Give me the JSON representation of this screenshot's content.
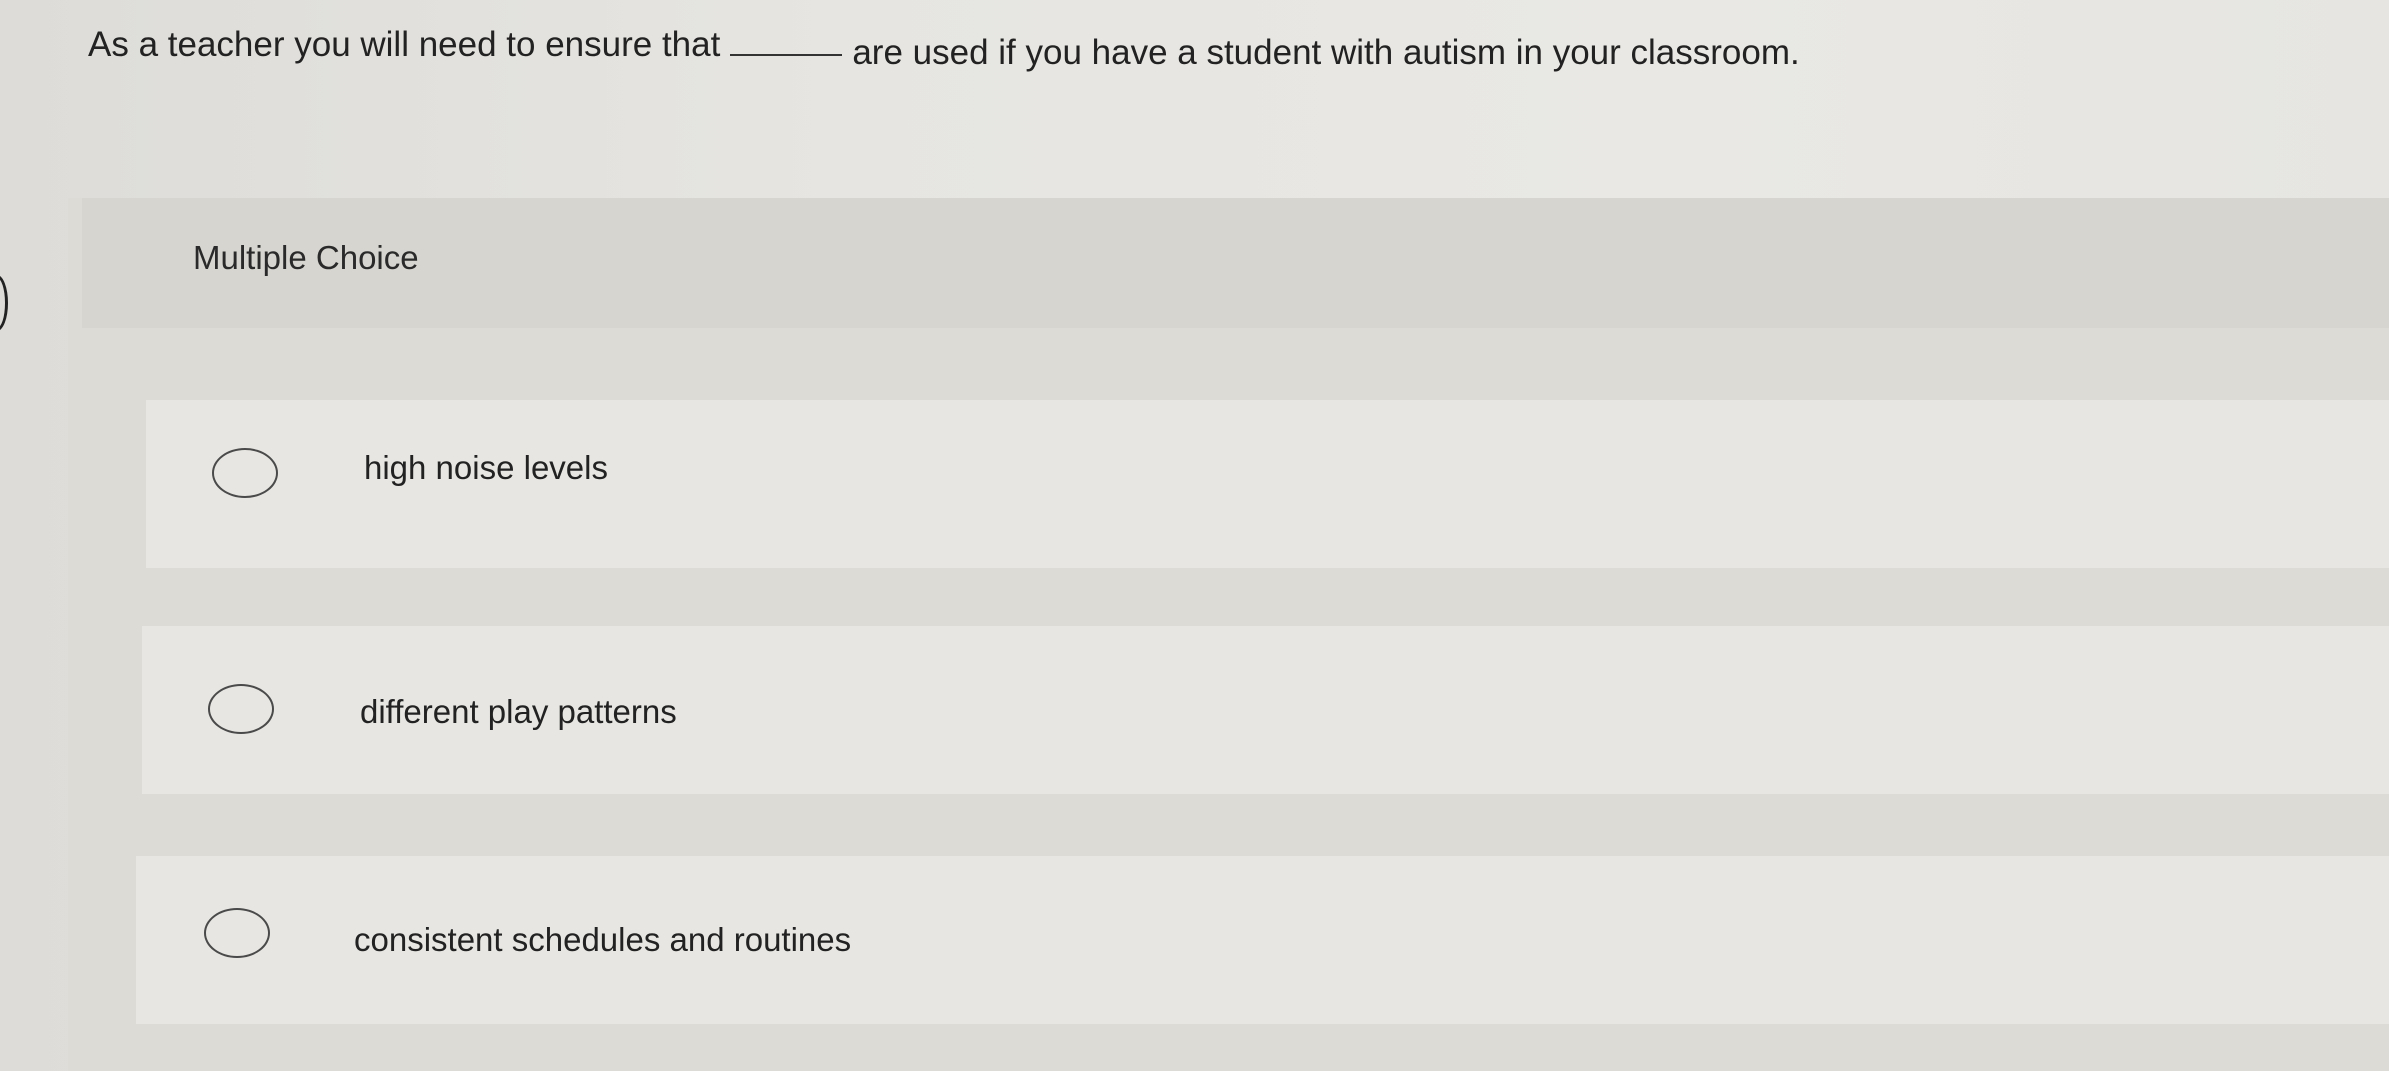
{
  "question": {
    "text_before": "As a teacher you will need to ensure that",
    "text_after": "are used if you have a student with autism in your classroom."
  },
  "multiple_choice": {
    "label": "Multiple Choice",
    "options": [
      {
        "label": "high noise levels",
        "selected": false
      },
      {
        "label": "different play patterns",
        "selected": false
      },
      {
        "label": "consistent schedules and routines",
        "selected": false
      }
    ]
  }
}
